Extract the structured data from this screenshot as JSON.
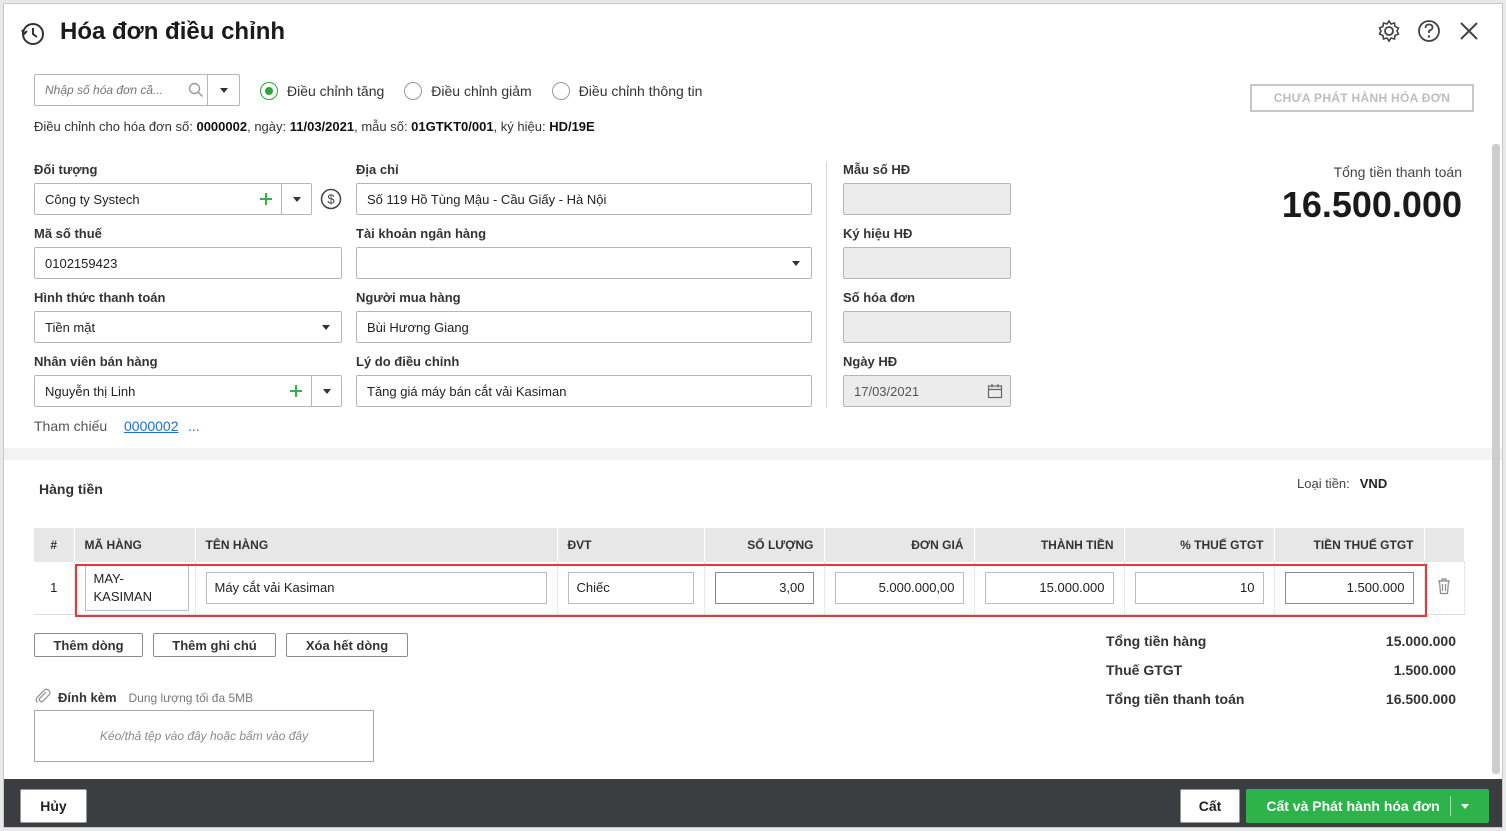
{
  "window": {
    "title": "Hóa đơn điều chỉnh"
  },
  "search": {
    "placeholder": "Nhập số hóa đơn cầ..."
  },
  "adjust_types": [
    {
      "label": "Điều chỉnh tăng",
      "checked": true
    },
    {
      "label": "Điều chỉnh giảm",
      "checked": false
    },
    {
      "label": "Điều chỉnh thông tin",
      "checked": false
    }
  ],
  "status_button": "CHƯA PHÁT HÀNH HÓA ĐƠN",
  "adjust_info": {
    "prefix": "Điều chỉnh cho hóa đơn số: ",
    "number": "0000002",
    "date_label": ", ngày: ",
    "date": "11/03/2021",
    "form_label": ", mẫu số: ",
    "form": "01GTKT0/001",
    "symbol_label": ", ký hiệu: ",
    "symbol": "HD/19E"
  },
  "form": {
    "customer_label": "Đối tượng",
    "customer_value": "Công ty Systech",
    "address_label": "Địa chỉ",
    "address_value": "Số 119 Hồ Tùng Mậu - Cầu Giấy - Hà Nội",
    "tax_code_label": "Mã số thuế",
    "tax_code_value": "0102159423",
    "bank_account_label": "Tài khoản ngân hàng",
    "bank_account_value": "",
    "payment_method_label": "Hình thức thanh toán",
    "payment_method_value": "Tiền mặt",
    "buyer_label": "Người mua hàng",
    "buyer_value": "Bùi Hương Giang",
    "salesperson_label": "Nhân viên bán hàng",
    "salesperson_value": "Nguyễn thị Linh",
    "reason_label": "Lý do điều chỉnh",
    "reason_value": "Tăng giá máy bán cắt vải Kasiman",
    "invoice_form_label": "Mẫu số HĐ",
    "invoice_symbol_label": "Ký hiệu HĐ",
    "invoice_number_label": "Số hóa đơn",
    "invoice_date_label": "Ngày HĐ",
    "invoice_date_value": "17/03/2021"
  },
  "total": {
    "label": "Tổng tiền thanh toán",
    "value": "16.500.000"
  },
  "reference": {
    "label": "Tham chiếu",
    "link": "0000002",
    "more": "..."
  },
  "items_section": {
    "title": "Hàng tiền",
    "currency_label": "Loại tiền:",
    "currency_value": "VND"
  },
  "table": {
    "headers": [
      "#",
      "MÃ HÀNG",
      "TÊN HÀNG",
      "ĐVT",
      "SỐ LƯỢNG",
      "ĐƠN GIÁ",
      "THÀNH TIỀN",
      "% THUẾ GTGT",
      "TIỀN THUẾ GTGT"
    ],
    "rows": [
      {
        "index": "1",
        "code": "MAY-KASIMAN",
        "name": "Máy cắt vải Kasiman",
        "unit": "Chiếc",
        "quantity": "3,00",
        "unit_price": "5.000.000,00",
        "amount": "15.000.000",
        "vat_rate": "10",
        "vat_amount": "1.500.000"
      }
    ]
  },
  "row_actions": {
    "add_row": "Thêm dòng",
    "add_note": "Thêm ghi chú",
    "delete_all": "Xóa hết dòng"
  },
  "summary": {
    "goods_label": "Tổng tiền hàng",
    "goods_value": "15.000.000",
    "vat_label": "Thuế GTGT",
    "vat_value": "1.500.000",
    "total_label": "Tổng tiền thanh toán",
    "total_value": "16.500.000"
  },
  "attachment": {
    "label": "Đính kèm",
    "note": "Dung lượng tối đa 5MB",
    "dropzone": "Kéo/thả tệp vào đây hoặc bấm vào đây"
  },
  "footer": {
    "cancel": "Hủy",
    "save": "Cất",
    "save_issue": "Cất và Phát hành hóa đơn"
  },
  "colors": {
    "accent_green": "#2cb34a",
    "footer_bg": "#3b3d41",
    "highlight_red": "#e03a3a",
    "link_blue": "#1a73c9"
  }
}
